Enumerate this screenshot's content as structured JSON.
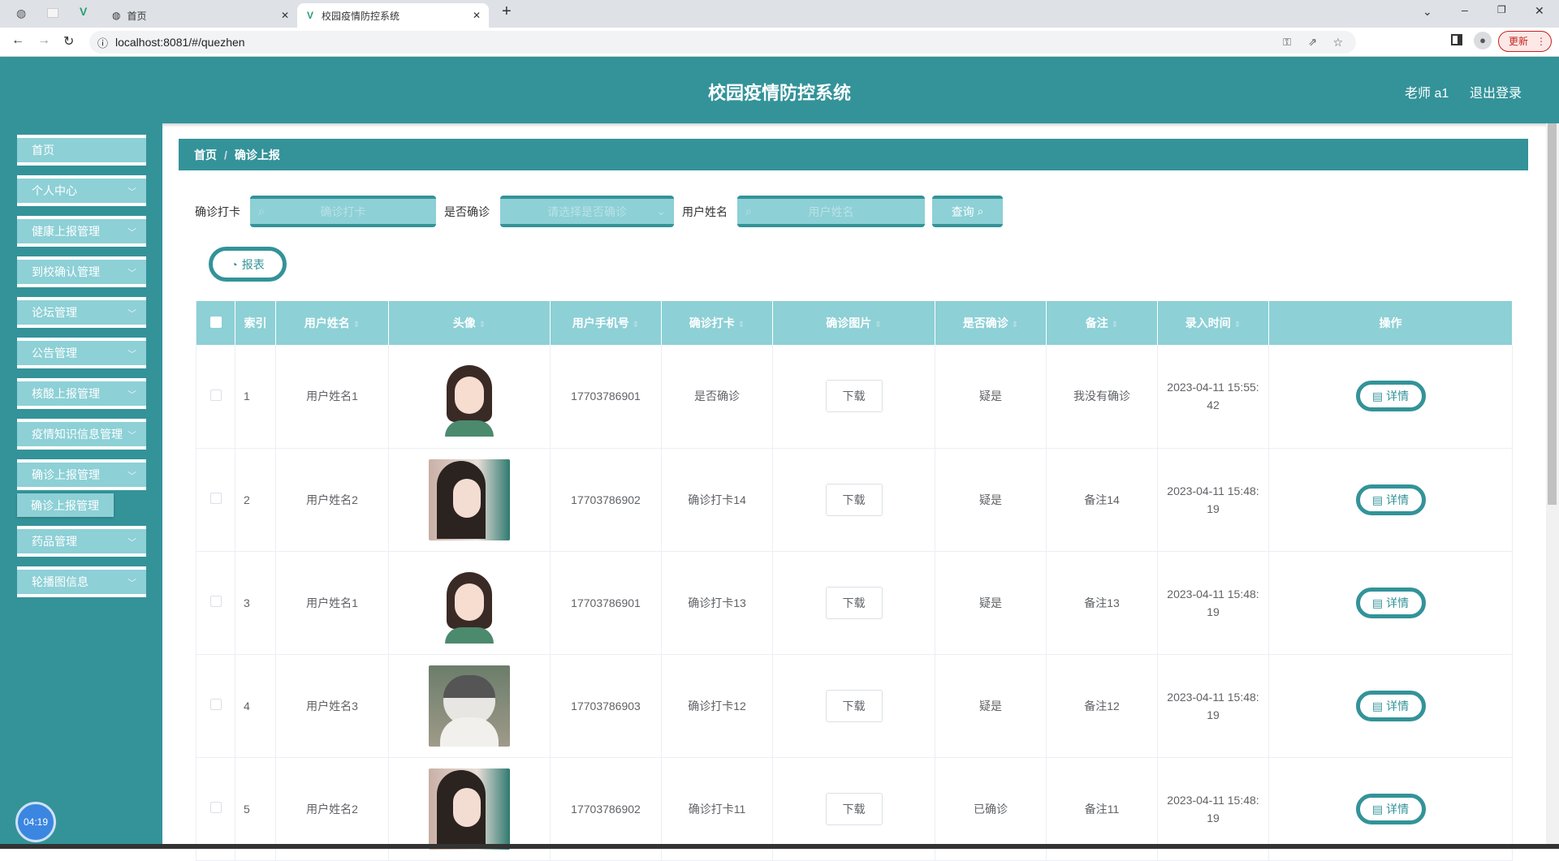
{
  "browser": {
    "tabs": [
      {
        "label": "首页"
      },
      {
        "label": "校园疫情防控系统"
      }
    ],
    "url": "localhost:8081/#/quezhen",
    "update_label": "更新"
  },
  "header": {
    "title": "校园疫情防控系统",
    "user": "老师 a1",
    "logout": "退出登录"
  },
  "sidebar": {
    "items": [
      {
        "label": "首页"
      },
      {
        "label": "个人中心"
      },
      {
        "label": "健康上报管理"
      },
      {
        "label": "到校确认管理"
      },
      {
        "label": "论坛管理"
      },
      {
        "label": "公告管理"
      },
      {
        "label": "核酸上报管理"
      },
      {
        "label": "疫情知识信息管理"
      },
      {
        "label": "确诊上报管理"
      },
      {
        "label": "药品管理"
      },
      {
        "label": "轮播图信息"
      }
    ],
    "submenu": "确诊上报管理",
    "clock": "04:19"
  },
  "breadcrumb": {
    "home": "首页",
    "sep": "/",
    "current": "确诊上报"
  },
  "search": {
    "f1_label": "确诊打卡",
    "f1_placeholder": "确诊打卡",
    "f2_label": "是否确诊",
    "f2_placeholder": "请选择是否确诊",
    "f3_label": "用户姓名",
    "f3_placeholder": "用户姓名",
    "query": "查询"
  },
  "report_button": "报表",
  "table": {
    "columns": [
      "索引",
      "用户姓名",
      "头像",
      "用户手机号",
      "确诊打卡",
      "确诊图片",
      "是否确诊",
      "备注",
      "录入时间",
      "操作"
    ],
    "download": "下载",
    "detail": "详情",
    "rows": [
      {
        "idx": "1",
        "name": "用户姓名1",
        "phone": "17703786901",
        "checkin": "是否确诊",
        "confirmed": "疑是",
        "note": "我没有确诊",
        "time": "2023-04-11 15:55:42"
      },
      {
        "idx": "2",
        "name": "用户姓名2",
        "phone": "17703786902",
        "checkin": "确诊打卡14",
        "confirmed": "疑是",
        "note": "备注14",
        "time": "2023-04-11 15:48:19"
      },
      {
        "idx": "3",
        "name": "用户姓名1",
        "phone": "17703786901",
        "checkin": "确诊打卡13",
        "confirmed": "疑是",
        "note": "备注13",
        "time": "2023-04-11 15:48:19"
      },
      {
        "idx": "4",
        "name": "用户姓名3",
        "phone": "17703786903",
        "checkin": "确诊打卡12",
        "confirmed": "疑是",
        "note": "备注12",
        "time": "2023-04-11 15:48:19"
      },
      {
        "idx": "5",
        "name": "用户姓名2",
        "phone": "17703786902",
        "checkin": "确诊打卡11",
        "confirmed": "已确诊",
        "note": "备注11",
        "time": "2023-04-11 15:48:19"
      }
    ]
  }
}
